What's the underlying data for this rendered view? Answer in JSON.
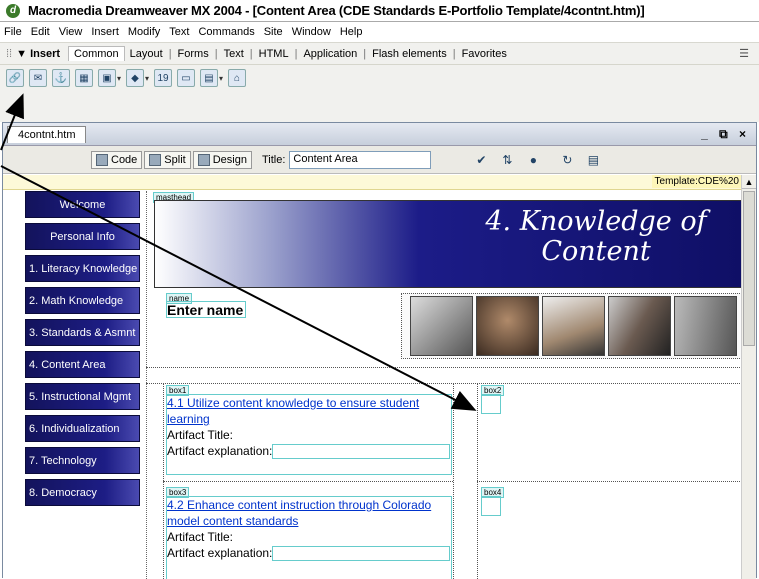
{
  "window": {
    "title": "Macromedia Dreamweaver MX 2004 - [Content Area (CDE Standards E-Portfolio Template/4contnt.htm)]",
    "logo_letter": "d"
  },
  "menu": [
    "File",
    "Edit",
    "View",
    "Insert",
    "Modify",
    "Text",
    "Commands",
    "Site",
    "Window",
    "Help"
  ],
  "insert_bar": {
    "label": "▼ Insert",
    "tabs": [
      "Common",
      "Layout",
      "Forms",
      "Text",
      "HTML",
      "Application",
      "Flash elements",
      "Favorites"
    ],
    "active_tab": "Common",
    "icons": [
      "hyperlink-icon",
      "email-link-icon",
      "named-anchor-icon",
      "table-icon",
      "image-icon",
      "media-icon",
      "date-icon",
      "comment-icon",
      "template-icon",
      "tag-chooser-icon"
    ]
  },
  "document": {
    "tab_name": "4contnt.htm",
    "window_controls": "_ ⧉ ×",
    "view_buttons": {
      "code": "Code",
      "split": "Split",
      "design": "Design"
    },
    "title_label": "Title:",
    "title_value": "Content Area",
    "template_label": "Template:CDE%20"
  },
  "nav": [
    "Welcome",
    "Personal Info",
    "1. Literacy Knowledge",
    "2. Math Knowledge",
    "3. Standards & Asmnt",
    "4. Content Area",
    "5. Instructional Mgmt",
    "6. Individualization",
    "7. Technology",
    "8. Democracy"
  ],
  "masthead": {
    "tag": "masthead",
    "title_line1": "4. Knowledge of",
    "title_line2": "Content"
  },
  "name_region": {
    "tag": "name",
    "text": "Enter name"
  },
  "box1": {
    "tag": "box1",
    "link": "4.1 Utilize content knowledge to ensure student learning",
    "artifact_title": "Artifact Title:",
    "artifact_explanation": "Artifact explanation:"
  },
  "box2": {
    "tag": "box2"
  },
  "box3": {
    "tag": "box3",
    "link": "4.2 Enhance content instruction through Colorado model content standards",
    "artifact_title": "Artifact Title:",
    "artifact_explanation": "Artifact explanation:"
  },
  "box4": {
    "tag": "box4"
  },
  "colors": {
    "nav_bg": "#1a1a7a",
    "masthead_dark": "#0f0f66",
    "link": "#0033cc",
    "region_outline": "#66cccc"
  }
}
